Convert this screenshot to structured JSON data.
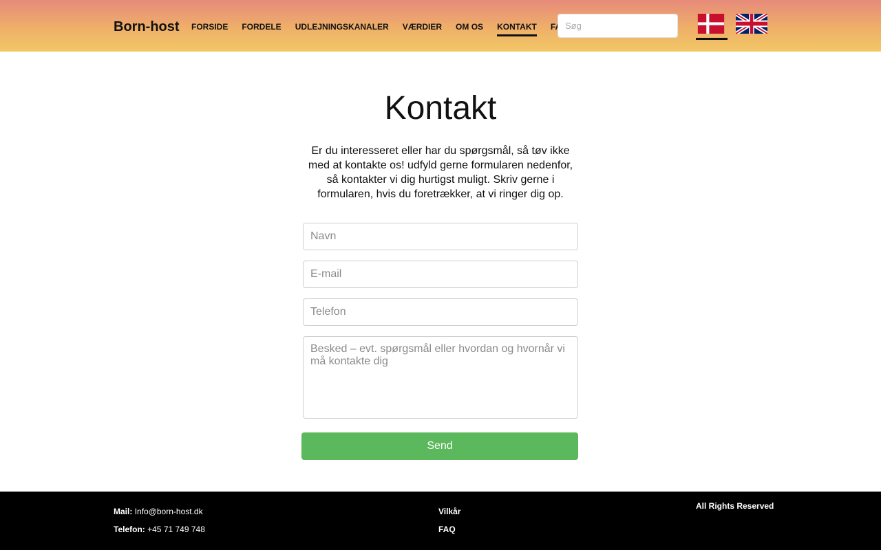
{
  "header": {
    "brand": "Born-host",
    "nav": [
      {
        "label": "FORSIDE",
        "active": false
      },
      {
        "label": "FORDELE",
        "active": false
      },
      {
        "label": "UDLEJNINGSKANALER",
        "active": false
      },
      {
        "label": "VÆRDIER",
        "active": false
      },
      {
        "label": "OM OS",
        "active": false
      },
      {
        "label": "KONTAKT",
        "active": true
      },
      {
        "label": "FAQ",
        "active": false
      }
    ],
    "search_placeholder": "Søg",
    "languages": [
      {
        "icon": "danish-flag-icon",
        "selected": true
      },
      {
        "icon": "uk-flag-icon",
        "selected": false
      }
    ]
  },
  "main": {
    "title": "Kontakt",
    "intro": "Er du interesseret eller har du spørgsmål, så tøv ikke med at kontakte os! udfyld gerne formularen nedenfor, så kontakter vi dig hurtigst muligt. Skriv gerne i formularen, hvis du foretrækker, at vi ringer dig op.",
    "form": {
      "name_placeholder": "Navn",
      "email_placeholder": "E-mail",
      "phone_placeholder": "Telefon",
      "message_placeholder": "Besked – evt. spørgsmål eller hvordan og hvornår vi må kontakte dig",
      "send_label": "Send"
    }
  },
  "footer": {
    "mail_label": "Mail:",
    "mail_value": "Info@born-host.dk",
    "phone_label": "Telefon:",
    "phone_value": "+45 71 749 748",
    "terms": "Vilkår",
    "faq": "FAQ",
    "rights": "All Rights Reserved"
  },
  "colors": {
    "header_gradient_top": "#e68a7a",
    "header_gradient_bottom": "#f2c765",
    "send_button": "#5cb85c",
    "footer_bg": "#000000"
  }
}
